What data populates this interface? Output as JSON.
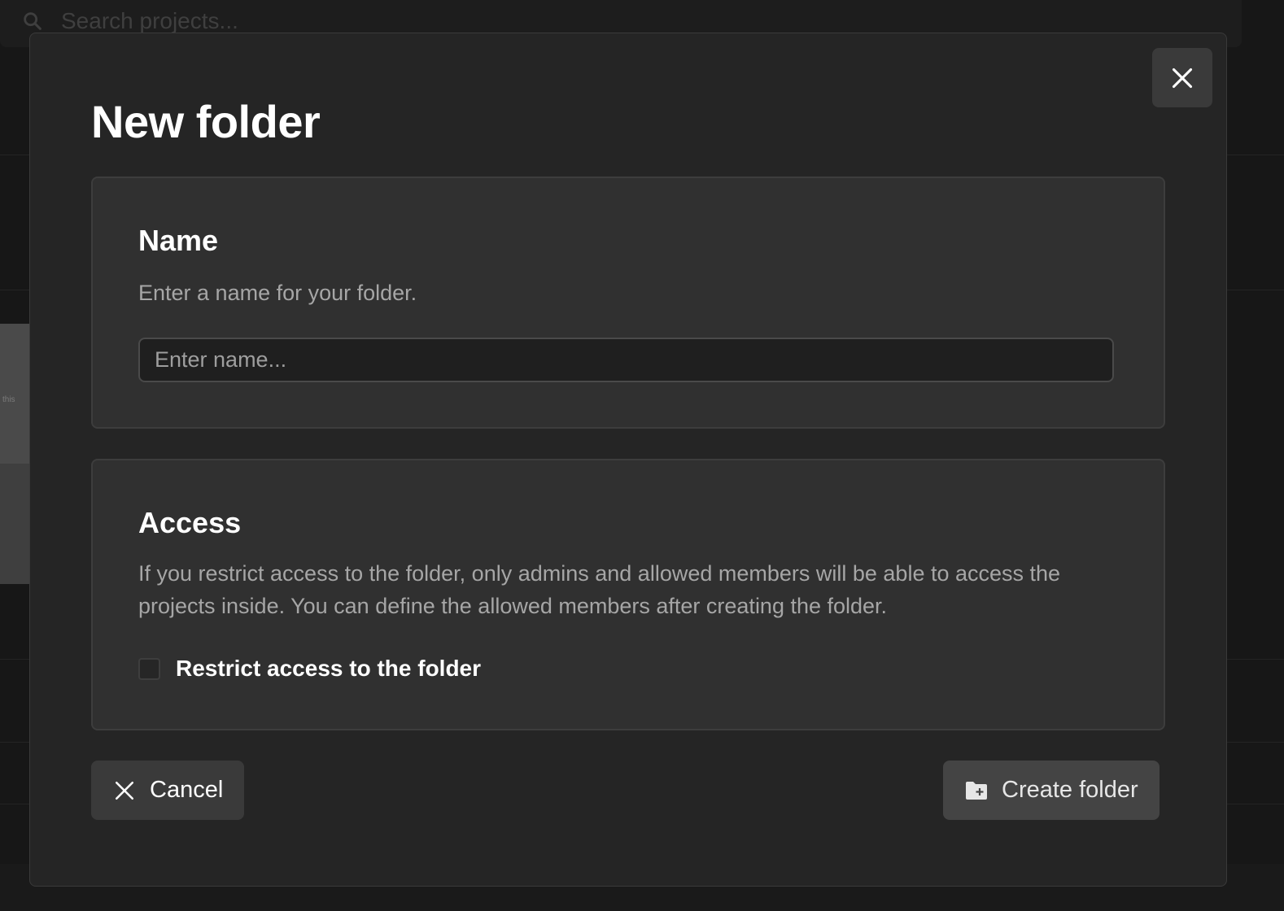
{
  "background": {
    "search_placeholder": "Search projects...",
    "thumb_text": "this"
  },
  "modal": {
    "title": "New folder",
    "close_icon": "close-icon",
    "name_section": {
      "heading": "Name",
      "description": "Enter a name for your folder.",
      "input_value": "",
      "input_placeholder": "Enter name..."
    },
    "access_section": {
      "heading": "Access",
      "description": "If you restrict access to the folder, only admins and allowed members will be able to access the projects inside. You can define the allowed members after creating the folder.",
      "checkbox_label": "Restrict access to the folder",
      "checkbox_checked": false
    },
    "footer": {
      "cancel_label": "Cancel",
      "create_label": "Create folder"
    }
  },
  "colors": {
    "modal_bg": "#252525",
    "card_bg": "#303030",
    "button_bg": "#3a3a3a",
    "text_primary": "#ffffff",
    "text_secondary": "#a6a6a6"
  }
}
